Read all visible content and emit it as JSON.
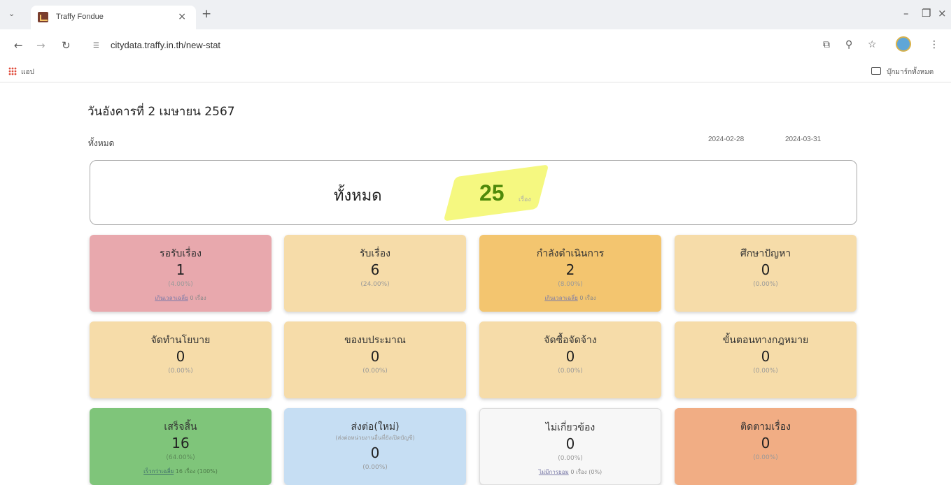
{
  "browser": {
    "tab_title": "Traffy Fondue",
    "url": "citydata.traffy.in.th/new-stat",
    "bookmarks_apps_label": "แอป",
    "bookmarks_all_label": "บุ๊กมาร์กทั้งหมด"
  },
  "page": {
    "date_heading": "วันอังคารที่ 2 เมษายน 2567",
    "filter_label": "ทั้งหมด",
    "date_from": "2024-02-28",
    "date_to": "2024-03-31"
  },
  "total": {
    "label": "ทั้งหมด",
    "value": "25",
    "unit": "เรื่อง"
  },
  "cards": [
    {
      "title": "รอรับเรื่อง",
      "value": "1",
      "percent": "(4.00%)",
      "sub_link": "เกินเวลาเฉลี่ย",
      "sub_text": "0 เรื่อง",
      "color": "#e8a8ad"
    },
    {
      "title": "รับเรื่อง",
      "value": "6",
      "percent": "(24.00%)",
      "color": "#f6dca9"
    },
    {
      "title": "กำลังดำเนินการ",
      "value": "2",
      "percent": "(8.00%)",
      "sub_link": "เกินเวลาเฉลี่ย",
      "sub_text": "0 เรื่อง",
      "color": "#f3c56f"
    },
    {
      "title": "ศึกษาปัญหา",
      "value": "0",
      "percent": "(0.00%)",
      "color": "#f6dca9"
    },
    {
      "title": "จัดทำนโยบาย",
      "value": "0",
      "percent": "(0.00%)",
      "color": "#f6dca9"
    },
    {
      "title": "ของบประมาณ",
      "value": "0",
      "percent": "(0.00%)",
      "color": "#f6dca9"
    },
    {
      "title": "จัดซื้อจัดจ้าง",
      "value": "0",
      "percent": "(0.00%)",
      "color": "#f6dca9"
    },
    {
      "title": "ขั้นตอนทางกฎหมาย",
      "value": "0",
      "percent": "(0.00%)",
      "color": "#f6dca9"
    },
    {
      "title": "เสร็จสิ้น",
      "value": "16",
      "percent": "(64.00%)",
      "sub_link": "เร็วกว่าเฉลี่ย",
      "sub_text": "16 เรื่อง (100%)",
      "color": "#7fc57a"
    },
    {
      "title": "ส่งต่อ(ใหม่)",
      "note": "(ส่งต่อหน่วยงานอื่นที่ยังเปิดบัญชี)",
      "value": "0",
      "percent": "(0.00%)",
      "color": "#c6def3"
    },
    {
      "title": "ไม่เกี่ยวข้อง",
      "value": "0",
      "percent": "(0.00%)",
      "sub_link": "ไม่มีการยอม",
      "sub_text": "0 เรื่อง (0%)",
      "color": "#f7f7f7"
    },
    {
      "title": "ติดตามเรื่อง",
      "value": "0",
      "percent": "(0.00%)",
      "color": "#f1ad84"
    }
  ]
}
